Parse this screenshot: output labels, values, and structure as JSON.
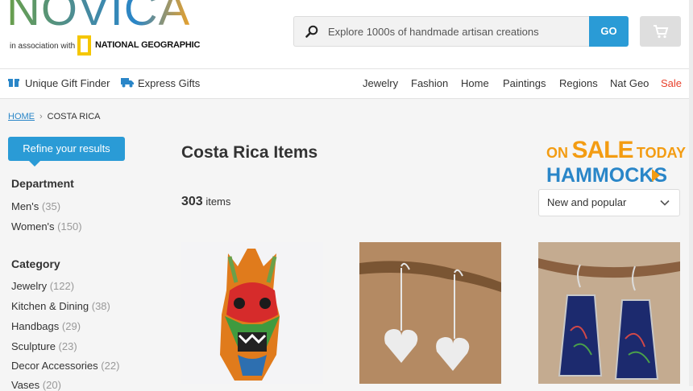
{
  "header": {
    "logo": "NOVICA",
    "association": "in association with",
    "partner": "NATIONAL GEOGRAPHIC",
    "search_placeholder": "Explore 1000s of handmade artisan creations",
    "search_button": "GO"
  },
  "nav": {
    "gift_finder": "Unique Gift Finder",
    "express": "Express Gifts",
    "links": [
      "Jewelry",
      "Fashion",
      "Home",
      "Paintings",
      "Regions",
      "Nat Geo",
      "Sale"
    ]
  },
  "breadcrumb": {
    "home": "HOME",
    "current": "COSTA RICA"
  },
  "sidebar": {
    "refine": "Refine your results",
    "department_title": "Department",
    "departments": [
      {
        "label": "Men's",
        "count": "(35)"
      },
      {
        "label": "Women's",
        "count": "(150)"
      }
    ],
    "category_title": "Category",
    "categories": [
      {
        "label": "Jewelry",
        "count": "(122)"
      },
      {
        "label": "Kitchen & Dining",
        "count": "(38)"
      },
      {
        "label": "Handbags",
        "count": "(29)"
      },
      {
        "label": "Sculpture",
        "count": "(23)"
      },
      {
        "label": "Decor Accessories",
        "count": "(22)"
      },
      {
        "label": "Vases",
        "count": "(20)"
      }
    ]
  },
  "main": {
    "title": "Costa Rica Items",
    "count": "303",
    "count_suffix": "items",
    "sort_selected": "New and popular"
  },
  "promo": {
    "on": "ON",
    "sale": "SALE",
    "today": "TODAY",
    "item": "HAMMOCKS"
  },
  "colors": {
    "accent": "#2a9bd6",
    "sale": "#e8412c",
    "promo_orange": "#f39c12"
  }
}
